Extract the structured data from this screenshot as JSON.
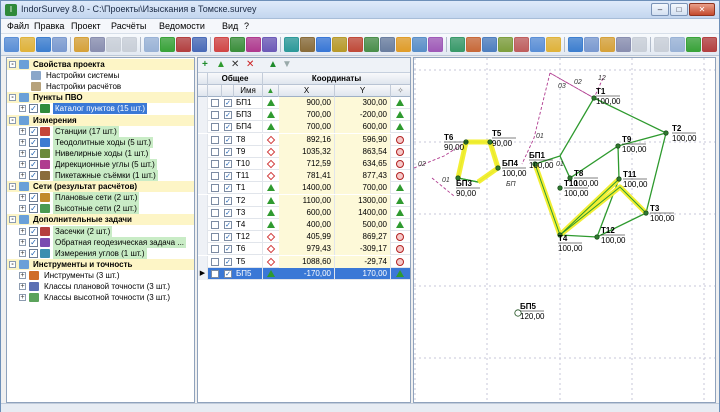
{
  "window": {
    "title": "IndorSurvey 8.0 - C:\\Проекты\\Изыскания в Томске.survey",
    "btn_min": "–",
    "btn_max": "□",
    "btn_close": "✕"
  },
  "menu": [
    "Файл",
    "Правка",
    "Проект",
    "Расчёты",
    "Ведомости",
    "Вид",
    "?"
  ],
  "tree": [
    {
      "label": "Свойства проекта",
      "cat": true,
      "exp": "-"
    },
    {
      "label": "Настройки системы",
      "indent": 2,
      "icon": "#8aa6c9"
    },
    {
      "label": "Настройки расчётов",
      "indent": 2,
      "icon": "#b7a27b"
    },
    {
      "label": "Пункты ПВО",
      "cat": true,
      "exp": "-"
    },
    {
      "label": "Каталог пунктов (15 шт.)",
      "indent": 1,
      "exp": "+",
      "check": true,
      "icon": "#2e8b3c",
      "sel": true
    },
    {
      "label": "Измерения",
      "cat": true,
      "exp": "-"
    },
    {
      "label": "Станции (17 шт.)",
      "indent": 1,
      "exp": "+",
      "check": true,
      "icon": "#c5463a",
      "style": "green"
    },
    {
      "label": "Теодолитные ходы (5 шт.)",
      "indent": 1,
      "exp": "+",
      "check": true,
      "icon": "#3d7bd1",
      "style": "green"
    },
    {
      "label": "Нивелирные ходы (1 шт.)",
      "indent": 1,
      "exp": "+",
      "check": true,
      "icon": "#6b8b3a",
      "style": "green"
    },
    {
      "label": "Дирекционные углы (5 шт.)",
      "indent": 1,
      "exp": "+",
      "check": true,
      "icon": "#b03b8f",
      "style": "green"
    },
    {
      "label": "Пикетажные съёмки (1 шт.)",
      "indent": 1,
      "exp": "+",
      "check": true,
      "icon": "#8a6d3b",
      "style": "green"
    },
    {
      "label": "Сети (результат расчётов)",
      "cat": true,
      "exp": "-"
    },
    {
      "label": "Плановые сети (2 шт.)",
      "indent": 1,
      "exp": "+",
      "check": true,
      "icon": "#c28a2b",
      "style": "green"
    },
    {
      "label": "Высотные сети (2 шт.)",
      "indent": 1,
      "exp": "+",
      "check": true,
      "icon": "#4a9a52",
      "style": "green"
    },
    {
      "label": "Дополнительные задачи",
      "cat": true,
      "exp": "-"
    },
    {
      "label": "Засечки (2 шт.)",
      "indent": 1,
      "exp": "+",
      "check": true,
      "icon": "#b53f3f",
      "style": "green"
    },
    {
      "label": "Обратная геодезическая задача ...",
      "indent": 1,
      "exp": "+",
      "check": true,
      "icon": "#7a4bb0",
      "style": "green"
    },
    {
      "label": "Измерения углов (1 шт.)",
      "indent": 1,
      "exp": "+",
      "check": true,
      "icon": "#3c8fb0",
      "style": "green"
    },
    {
      "label": "Инструменты и точность",
      "cat": true,
      "exp": "-"
    },
    {
      "label": "Инструменты (3 шт.)",
      "indent": 1,
      "exp": "+",
      "icon": "#cf6d2a"
    },
    {
      "label": "Классы плановой точности (3 шт.)",
      "indent": 1,
      "exp": "+",
      "icon": "#5b6fb3"
    },
    {
      "label": "Классы высотной точности (3 шт.)",
      "indent": 1,
      "exp": "+",
      "icon": "#5ba35b"
    }
  ],
  "table": {
    "group_general": "Общее",
    "group_coords": "Координаты",
    "col_name": "Имя",
    "col_x": "X",
    "col_y": "Y",
    "rows": [
      {
        "name": "БП1",
        "x": "900,00",
        "y": "300,00",
        "type": "tri"
      },
      {
        "name": "БП3",
        "x": "700,00",
        "y": "-200,00",
        "type": "tri"
      },
      {
        "name": "БП4",
        "x": "700,00",
        "y": "600,00",
        "type": "tri"
      },
      {
        "name": "T8",
        "x": "892,16",
        "y": "596,90",
        "type": "dia"
      },
      {
        "name": "T9",
        "x": "1035,32",
        "y": "863,54",
        "type": "dia"
      },
      {
        "name": "T10",
        "x": "712,59",
        "y": "634,65",
        "type": "dia"
      },
      {
        "name": "T11",
        "x": "781,41",
        "y": "877,43",
        "type": "dia"
      },
      {
        "name": "T1",
        "x": "1400,00",
        "y": "700,00",
        "type": "tri"
      },
      {
        "name": "T2",
        "x": "1100,00",
        "y": "1300,00",
        "type": "tri"
      },
      {
        "name": "T3",
        "x": "600,00",
        "y": "1400,00",
        "type": "tri"
      },
      {
        "name": "T4",
        "x": "400,00",
        "y": "500,00",
        "type": "tri"
      },
      {
        "name": "T12",
        "x": "405,99",
        "y": "869,27",
        "type": "dia"
      },
      {
        "name": "T6",
        "x": "979,43",
        "y": "-309,17",
        "type": "dia"
      },
      {
        "name": "T5",
        "x": "1088,60",
        "y": "-29,74",
        "type": "dia"
      },
      {
        "name": "БП5",
        "x": "-170,00",
        "y": "170,00",
        "type": "tri",
        "sel": true
      }
    ]
  },
  "map": {
    "points": [
      {
        "name": "T1",
        "value": "100,00"
      },
      {
        "name": "T2",
        "value": "100,00"
      },
      {
        "name": "T3",
        "value": "100,00"
      },
      {
        "name": "T4",
        "value": "100,00"
      },
      {
        "name": "T5",
        "value": "90,00"
      },
      {
        "name": "T6",
        "value": "90,00"
      },
      {
        "name": "T8",
        "value": "100,00"
      },
      {
        "name": "T9",
        "value": "100,00"
      },
      {
        "name": "T10",
        "value": "100,00"
      },
      {
        "name": "T11",
        "value": "100,00"
      },
      {
        "name": "T12",
        "value": "100,00"
      },
      {
        "name": "БП1",
        "value": "100,00"
      },
      {
        "name": "БП3",
        "value": "90,00"
      },
      {
        "name": "БП4",
        "value": "100,00"
      },
      {
        "name": "БП5",
        "value": "120,00"
      }
    ],
    "small_labels": [
      "02",
      "12",
      "03",
      "01",
      "01",
      "02",
      "01",
      "БП"
    ]
  },
  "colors": {
    "accent": "#3a78d6",
    "highlight_path": "#f2ee2a",
    "path_line": "#2e9a2e",
    "measure_line": "#b03b8f",
    "category_bg": "#fdf5c6",
    "green_bg": "#c9ecc6"
  }
}
